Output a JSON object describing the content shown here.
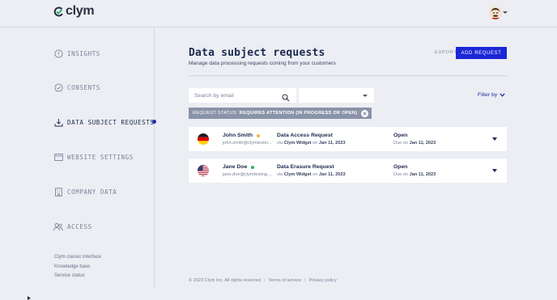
{
  "brand": {
    "name": "clym",
    "accent": "#1b26d6",
    "check_color": "#2fb36b"
  },
  "header": {
    "avatar_icon": "user-avatar-icon",
    "avatar_menu_icon": "caret-down-icon"
  },
  "sidebar": {
    "items": [
      {
        "label": "INSIGHTS",
        "icon": "insights-icon"
      },
      {
        "label": "CONSENTS",
        "icon": "check-circle-icon"
      },
      {
        "label": "DATA SUBJECT REQUESTS",
        "icon": "download-tray-icon",
        "active": true
      },
      {
        "label": "WEBSITE SETTINGS",
        "icon": "browser-window-icon"
      },
      {
        "label": "COMPANY DATA",
        "icon": "building-icon"
      },
      {
        "label": "ACCESS",
        "icon": "users-icon"
      }
    ],
    "links": [
      "Clym classic interface",
      "Knowledge base",
      "Service status"
    ]
  },
  "main": {
    "title": "Data subject requests",
    "subtitle": "Manage data processing requests coming from your customers",
    "export_label": "EXPORT",
    "add_label": "ADD REQUEST",
    "search": {
      "placeholder": "Search by email"
    },
    "select": {
      "value": ""
    },
    "filter_label": "Filter by",
    "chip": {
      "prefix": "REQUEST STATUS:",
      "value": "REQUIRES ATTENTION (IN PROGRESS OR OPEN)"
    },
    "requests": [
      {
        "flag": "germany-flag-icon",
        "name": "John Smith",
        "status_dot_color": "#f2b636",
        "email": "john.smith@clymtestin...",
        "type": "Data Access Request",
        "via_prefix": "via",
        "via_source": "Clym Widget",
        "via_on": "on",
        "date": "Jan 11, 2023",
        "status": "Open",
        "due_prefix": "Due on",
        "due_date": "Jan 11, 2023"
      },
      {
        "flag": "usa-flag-icon",
        "name": "Jane Doe",
        "status_dot_color": "#2fb36b",
        "email": "jane.doe@clymtesting....",
        "type": "Data Erasure Request",
        "via_prefix": "via",
        "via_source": "Clym Widget",
        "via_on": "on",
        "date": "Jan 11, 2023",
        "status": "Open",
        "due_prefix": "Due on",
        "due_date": "Jan 11, 2023"
      }
    ]
  },
  "footer": {
    "copyright": "© 2023 Clym Inc. All rights reserved",
    "terms": "Terms of service",
    "privacy": "Privacy policy"
  }
}
